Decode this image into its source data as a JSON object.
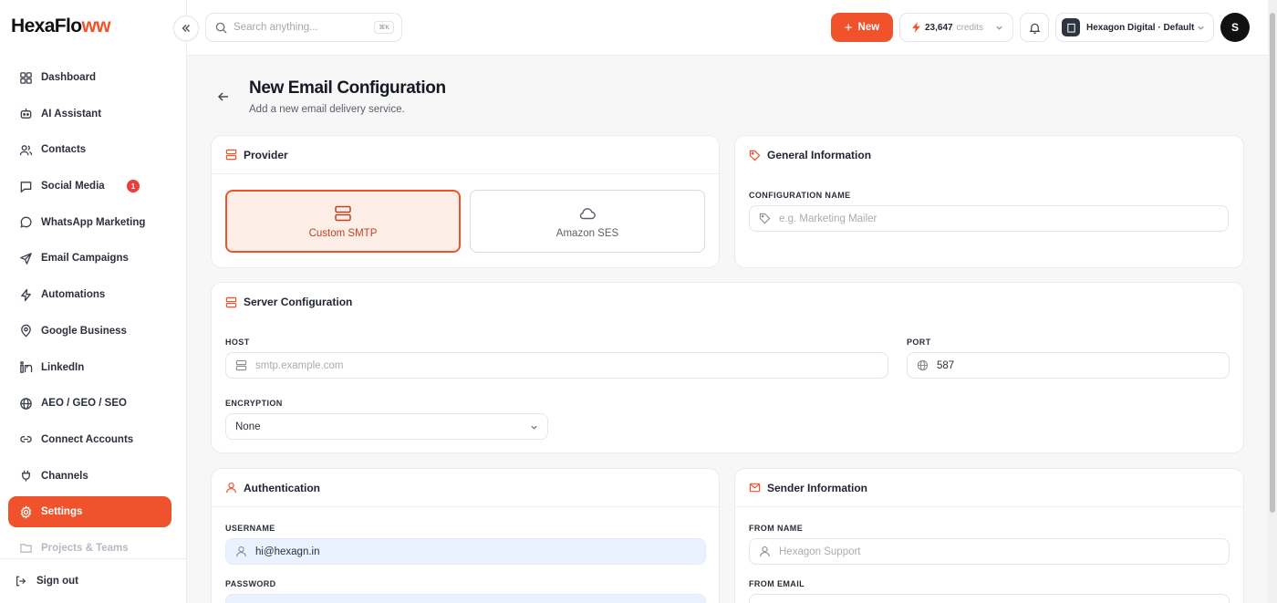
{
  "brand": {
    "name_main": "HexaFlo",
    "name_accent": "ww",
    "accent": "#f0532c"
  },
  "sidebar": {
    "items": [
      {
        "label": "Dashboard",
        "icon": "grid-icon"
      },
      {
        "label": "AI Assistant",
        "icon": "bot-icon"
      },
      {
        "label": "Contacts",
        "icon": "users-icon"
      },
      {
        "label": "Social Media",
        "icon": "chat-square-icon",
        "badge": "1"
      },
      {
        "label": "WhatsApp Marketing",
        "icon": "chat-round-icon"
      },
      {
        "label": "Email Campaigns",
        "icon": "send-icon"
      },
      {
        "label": "Automations",
        "icon": "bolt-icon"
      },
      {
        "label": "Google Business",
        "icon": "pin-icon"
      },
      {
        "label": "LinkedIn",
        "icon": "linkedin-icon"
      },
      {
        "label": "AEO / GEO / SEO",
        "icon": "globe-icon"
      },
      {
        "label": "Connect Accounts",
        "icon": "link-icon"
      },
      {
        "label": "Channels",
        "icon": "plug-icon"
      },
      {
        "label": "Settings",
        "icon": "gear-icon",
        "active": true
      },
      {
        "label": "Projects & Teams",
        "icon": "folder-icon"
      }
    ],
    "signout_label": "Sign out"
  },
  "topbar": {
    "search_placeholder": "Search anything...",
    "search_shortcut": "⌘K",
    "new_label": "New",
    "credits_value": "23,647",
    "credits_label": "credits",
    "workspace_label": "Hexagon Digital · Default",
    "avatar_initial": "S"
  },
  "page": {
    "title": "New Email Configuration",
    "subtitle": "Add a new email delivery service."
  },
  "provider": {
    "title": "Provider",
    "options": [
      {
        "label": "Custom SMTP",
        "selected": true
      },
      {
        "label": "Amazon SES",
        "selected": false
      }
    ]
  },
  "general": {
    "title": "General Information",
    "config_name_label": "CONFIGURATION NAME",
    "config_name_placeholder": "e.g. Marketing Mailer"
  },
  "server": {
    "title": "Server Configuration",
    "host_label": "HOST",
    "host_placeholder": "smtp.example.com",
    "port_label": "PORT",
    "port_value": "587",
    "encryption_label": "ENCRYPTION",
    "encryption_value": "None"
  },
  "auth": {
    "title": "Authentication",
    "username_label": "USERNAME",
    "username_value": "hi@hexagn.in",
    "password_label": "PASSWORD"
  },
  "sender": {
    "title": "Sender Information",
    "from_name_label": "FROM NAME",
    "from_name_placeholder": "Hexagon Support",
    "from_email_label": "FROM EMAIL"
  }
}
